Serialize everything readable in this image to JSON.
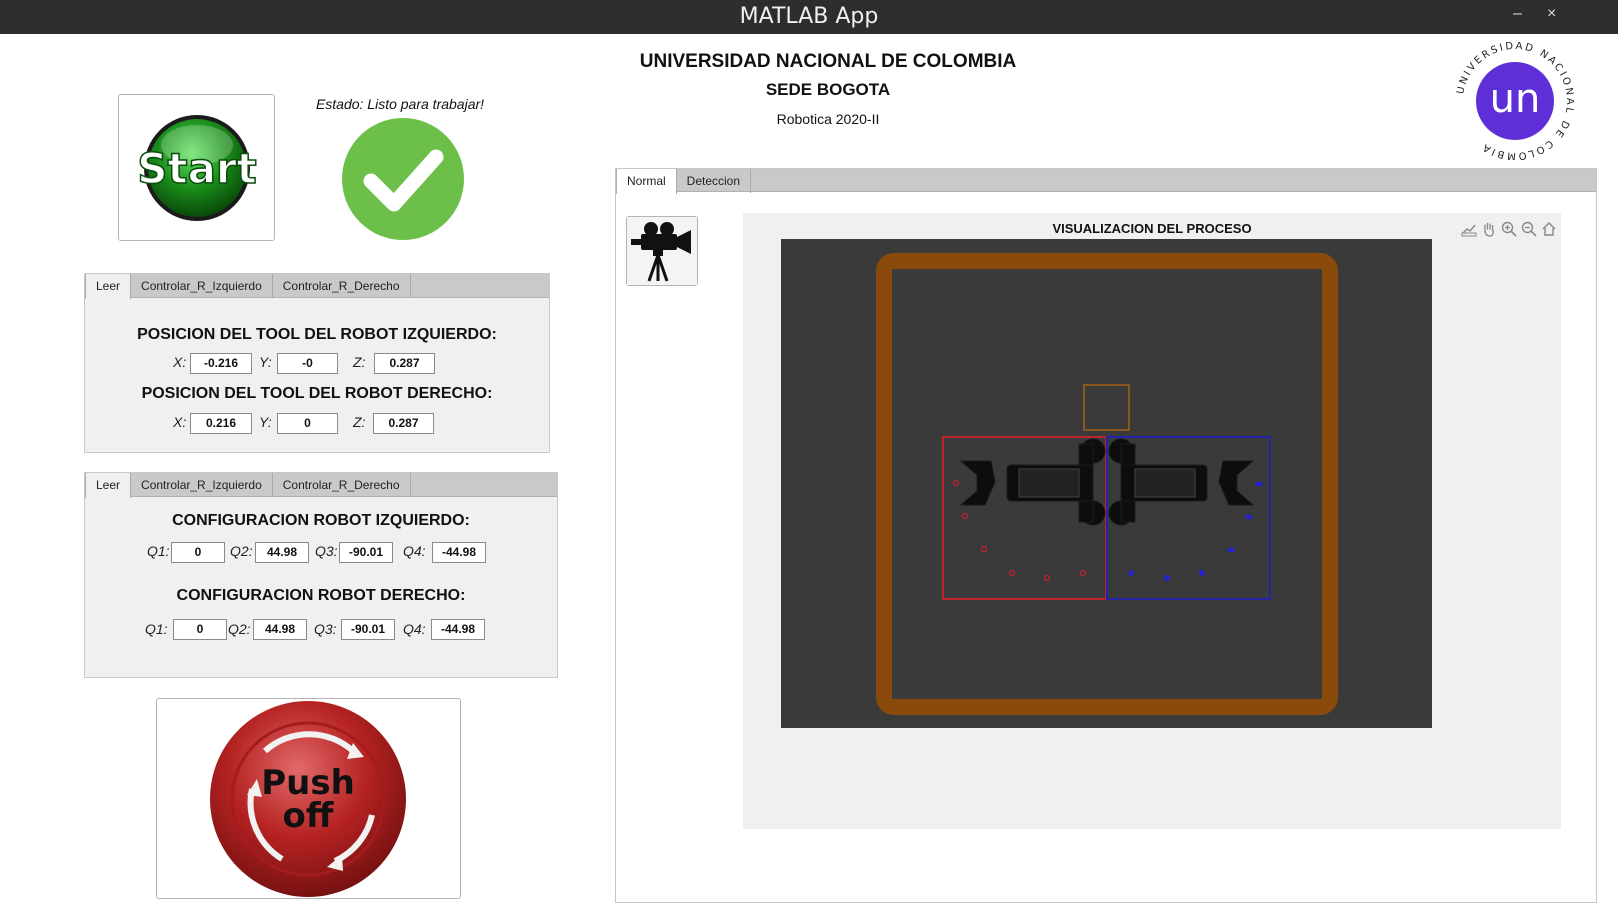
{
  "window": {
    "title": "MATLAB App",
    "minimize_glyph": "–",
    "close_glyph": "×"
  },
  "header": {
    "university": "UNIVERSIDAD NACIONAL DE COLOMBIA",
    "campus": "SEDE BOGOTA",
    "course": "Robotica 2020-II",
    "logo": {
      "mark": "un",
      "ring_text": "UNIVERSIDAD NACIONAL DE COLOMBIA",
      "color": "#5e2fd6"
    }
  },
  "start_button": {
    "label": "Start",
    "icon": "green-start-button",
    "color": "#1a8c1a"
  },
  "status": {
    "text": "Estado: Listo para trabajar!",
    "icon": "check-circle-icon",
    "color": "#6cc04a"
  },
  "position_panel": {
    "tabs": [
      "Leer",
      "Controlar_R_Izquierdo",
      "Controlar_R_Derecho"
    ],
    "active_tab": "Leer",
    "left": {
      "title": "POSICION DEL TOOL DEL ROBOT IZQUIERDO:",
      "x_label": "X:",
      "x": "-0.216",
      "y_label": "Y:",
      "y": "-0",
      "z_label": "Z:",
      "z": "0.287"
    },
    "right": {
      "title": "POSICION DEL TOOL DEL ROBOT DERECHO:",
      "x_label": "X:",
      "x": "0.216",
      "y_label": "Y:",
      "y": "0",
      "z_label": "Z:",
      "z": "0.287"
    }
  },
  "config_panel": {
    "tabs": [
      "Leer",
      "Controlar_R_Izquierdo",
      "Controlar_R_Derecho"
    ],
    "active_tab": "Leer",
    "left": {
      "title": "CONFIGURACION ROBOT IZQUIERDO:",
      "q1_label": "Q1:",
      "q1": "0",
      "q2_label": "Q2:",
      "q2": "44.98",
      "q3_label": "Q3:",
      "q3": "-90.01",
      "q4_label": "Q4:",
      "q4": "-44.98"
    },
    "right": {
      "title": "CONFIGURACION ROBOT DERECHO:",
      "q1_label": "Q1:",
      "q1": "0",
      "q2_label": "Q2:",
      "q2": "44.98",
      "q3_label": "Q3:",
      "q3": "-90.01",
      "q4_label": "Q4:",
      "q4": "-44.98"
    }
  },
  "push_off_button": {
    "line1": "Push",
    "line2": "off",
    "icon": "red-emergency-button",
    "color": "#b52222"
  },
  "view_panel": {
    "tabs": [
      "Normal",
      "Deteccion"
    ],
    "active_tab": "Normal",
    "camera_button": {
      "icon": "camera-tripod-icon"
    },
    "axes": {
      "title": "VISUALIZACION DEL PROCESO",
      "toolbar_icons": [
        "export-icon",
        "pan-hand-icon",
        "zoom-in-icon",
        "zoom-out-icon",
        "home-icon"
      ],
      "scene": {
        "background": "#3a3a3a",
        "table_border_color": "#8a4a0c",
        "left_workspace_color": "#c0232b",
        "right_workspace_color": "#2424a8",
        "target_color": "#c06a10"
      }
    }
  }
}
